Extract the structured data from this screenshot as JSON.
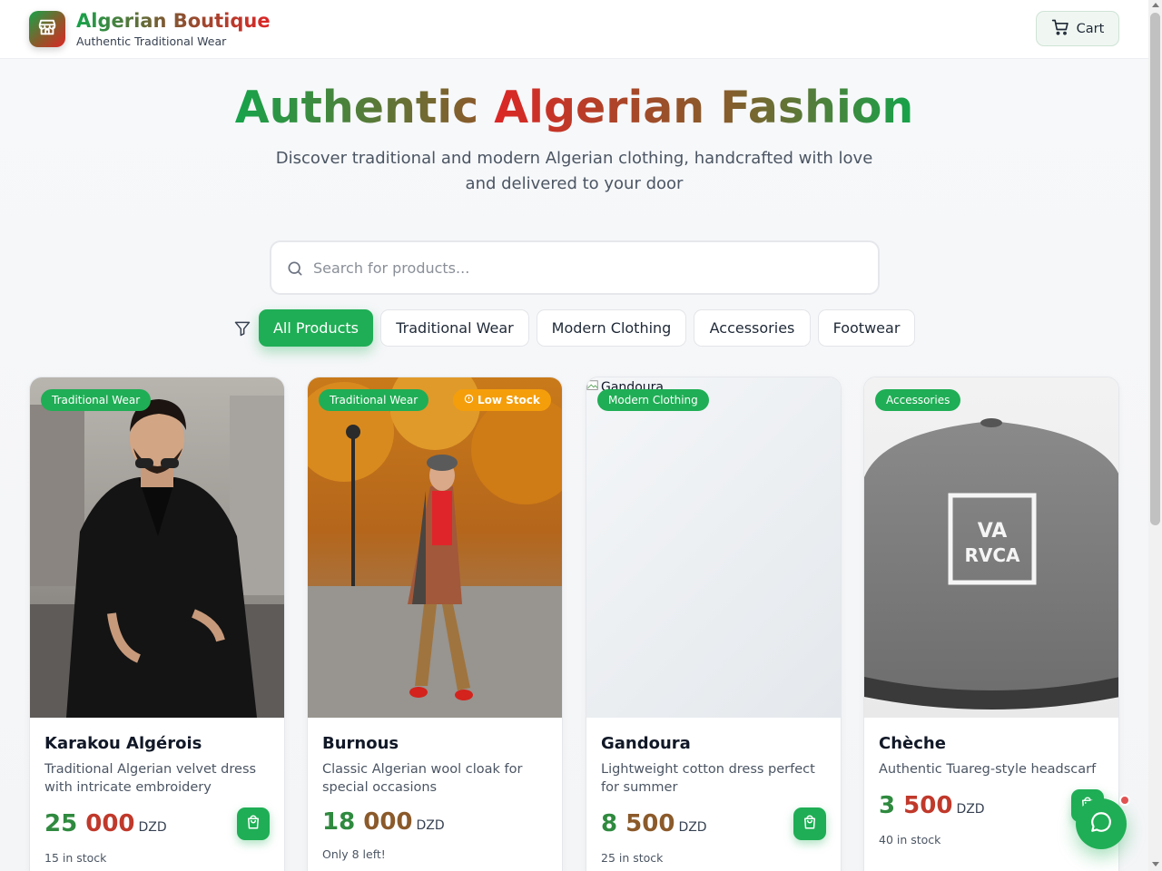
{
  "header": {
    "brand_title": "Algerian Boutique",
    "brand_subtitle": "Authentic Traditional Wear",
    "logo_icon": "store-icon",
    "cart_label": "Cart",
    "cart_icon": "shopping-cart-icon"
  },
  "hero": {
    "title_word1": "Authentic",
    "title_word2": "Algerian",
    "title_word3": "Fashion",
    "subtitle": "Discover traditional and modern Algerian clothing, handcrafted with love and delivered to your door"
  },
  "search": {
    "placeholder": "Search for products...",
    "value": "",
    "icon": "search-icon"
  },
  "filters": {
    "icon": "filter-icon",
    "selected": "All Products",
    "options": [
      {
        "label": "All Products"
      },
      {
        "label": "Traditional Wear"
      },
      {
        "label": "Modern Clothing"
      },
      {
        "label": "Accessories"
      },
      {
        "label": "Footwear"
      }
    ]
  },
  "products": [
    {
      "category": "Traditional Wear",
      "name": "Karakou Algérois",
      "description": "Traditional Algerian velvet dress with intricate embroidery",
      "price_thousands": "25",
      "price_rest": "000",
      "currency": "DZD",
      "stock_text": "15 in stock"
    },
    {
      "category": "Traditional Wear",
      "low_stock_badge": "Low Stock",
      "name": "Burnous",
      "description": "Classic Algerian wool cloak for special occasions",
      "price_thousands": "18",
      "price_rest": "000",
      "currency": "DZD",
      "stock_text": "Only 8 left!"
    },
    {
      "category": "Modern Clothing",
      "image_alt": "Gandoura",
      "name": "Gandoura",
      "description": "Lightweight cotton dress perfect for summer",
      "price_thousands": "8",
      "price_rest": "500",
      "currency": "DZD",
      "stock_text": "25 in stock"
    },
    {
      "category": "Accessories",
      "name": "Chèche",
      "description": "Authentic Tuareg-style headscarf",
      "price_thousands": "3",
      "price_rest": "500",
      "currency": "DZD",
      "stock_text": "40 in stock",
      "cap_logo_line1": "VA",
      "cap_logo_line2": "RVCA"
    }
  ],
  "chat": {
    "icon": "chat-bubble-icon",
    "notification": true
  },
  "colors": {
    "primary_green": "#1fae55",
    "brand_brown": "#8b5a2b",
    "brand_red": "#dc2626",
    "low_stock_orange": "#f59e0b"
  }
}
